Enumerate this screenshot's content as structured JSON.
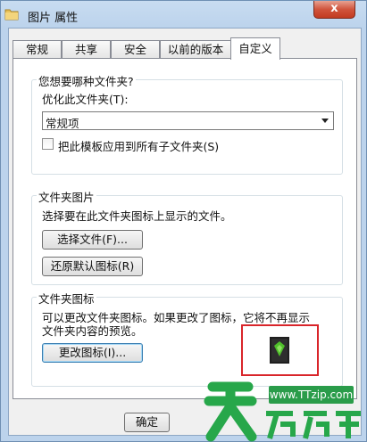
{
  "window": {
    "title": "图片 属性",
    "close_label": "x"
  },
  "tabs": [
    {
      "label": "常规"
    },
    {
      "label": "共享"
    },
    {
      "label": "安全"
    },
    {
      "label": "以前的版本"
    },
    {
      "label": "自定义"
    }
  ],
  "active_tab": "自定义",
  "folder_type_group": {
    "title": "您想要哪种文件夹?",
    "optimize_label": "优化此文件夹(T):",
    "optimize_value": "常规项",
    "apply_all_label": "把此模板应用到所有子文件夹(S)",
    "apply_all_checked": false
  },
  "folder_picture_group": {
    "title": "文件夹图片",
    "description": "选择要在此文件夹图标上显示的文件。",
    "choose_file_button": "选择文件(F)...",
    "restore_default_button": "还原默认图标(R)"
  },
  "folder_icon_group": {
    "title": "文件夹图标",
    "description_line1": "可以更改文件夹图标。如果更改了图标，它将不再显示",
    "description_line2": "文件夹内容的预览。",
    "change_icon_button": "更改图标(I)..."
  },
  "footer": {
    "ok_button": "确定"
  },
  "watermark": {
    "url_text": "www.TTzip.com",
    "brand_text": "天天下载"
  },
  "colors": {
    "highlight_box": "#d9252a",
    "watermark_green": "#2a9c4a"
  }
}
